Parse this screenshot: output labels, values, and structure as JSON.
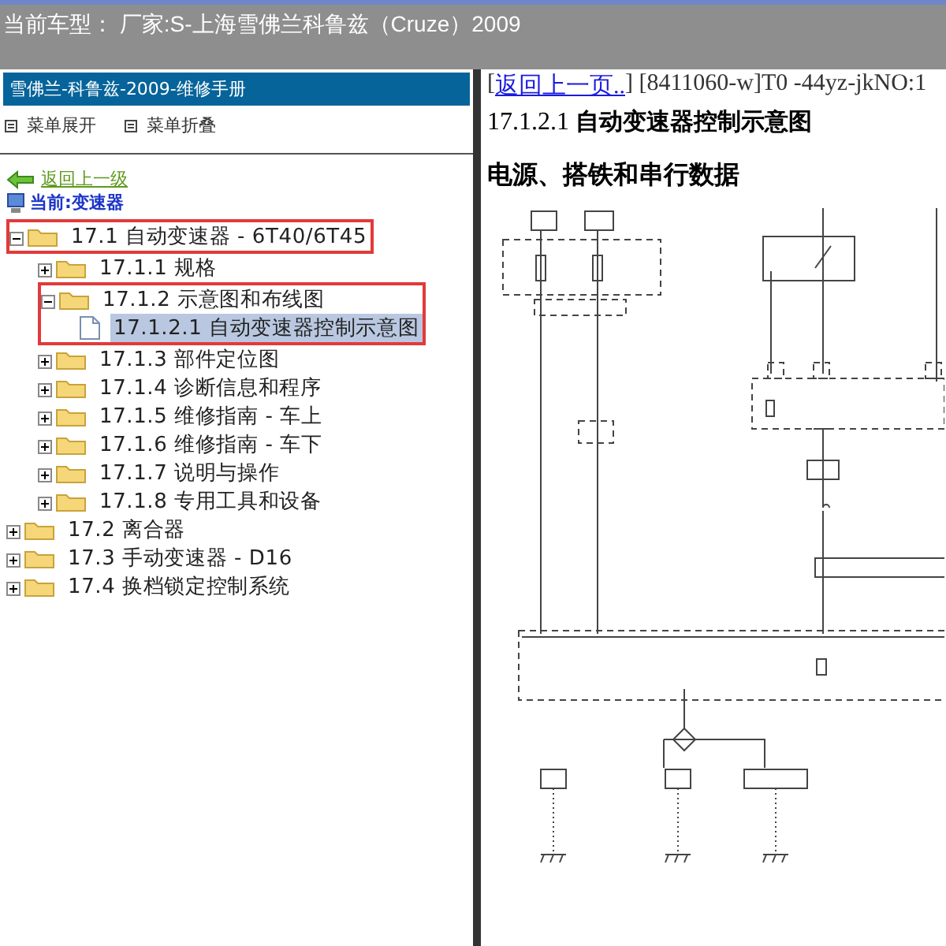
{
  "header": {
    "title": "当前车型： 厂家:S-上海雪佛兰科鲁兹（Cruze）2009"
  },
  "sidebar": {
    "title": "雪佛兰-科鲁兹-2009-维修手册",
    "tools": [
      {
        "label": "菜单展开"
      },
      {
        "label": "菜单折叠"
      }
    ],
    "back_link": "返回上一级",
    "current": "当前:变速器",
    "tree": [
      {
        "label": "17.1 自动变速器 - 6T40/6T45",
        "kind": "folder",
        "expanded": true,
        "selected": false,
        "outlined": true,
        "children": [
          {
            "label": "17.1.1 规格",
            "kind": "folder",
            "expanded": false,
            "selected": false
          },
          {
            "label": "17.1.2 示意图和布线图",
            "kind": "folder",
            "expanded": true,
            "selected": false,
            "branch_outlined": true,
            "children": [
              {
                "label": "17.1.2.1 自动变速器控制示意图",
                "kind": "doc",
                "selected": true
              }
            ]
          },
          {
            "label": "17.1.3 部件定位图",
            "kind": "folder",
            "expanded": false,
            "selected": false
          },
          {
            "label": "17.1.4 诊断信息和程序",
            "kind": "folder",
            "expanded": false,
            "selected": false
          },
          {
            "label": "17.1.5 维修指南 - 车上",
            "kind": "folder",
            "expanded": false,
            "selected": false
          },
          {
            "label": "17.1.6 维修指南 - 车下",
            "kind": "folder",
            "expanded": false,
            "selected": false
          },
          {
            "label": "17.1.7 说明与操作",
            "kind": "folder",
            "expanded": false,
            "selected": false
          },
          {
            "label": "17.1.8 专用工具和设备",
            "kind": "folder",
            "expanded": false,
            "selected": false
          }
        ]
      },
      {
        "label": "17.2 离合器",
        "kind": "folder",
        "expanded": false,
        "selected": false
      },
      {
        "label": "17.3 手动变速器 - D16",
        "kind": "folder",
        "expanded": false,
        "selected": false
      },
      {
        "label": "17.4 换档锁定控制系统",
        "kind": "folder",
        "expanded": false,
        "selected": false
      }
    ]
  },
  "content": {
    "open_bracket": "[",
    "back_link": "返回上一页..",
    "doc_code": "] [8411060-w]T0 -44yz-jkNO:1",
    "section_number": "17.1.2.1",
    "section_title": "自动变速器控制示意图",
    "heading": "电源、搭铁和串行数据"
  }
}
